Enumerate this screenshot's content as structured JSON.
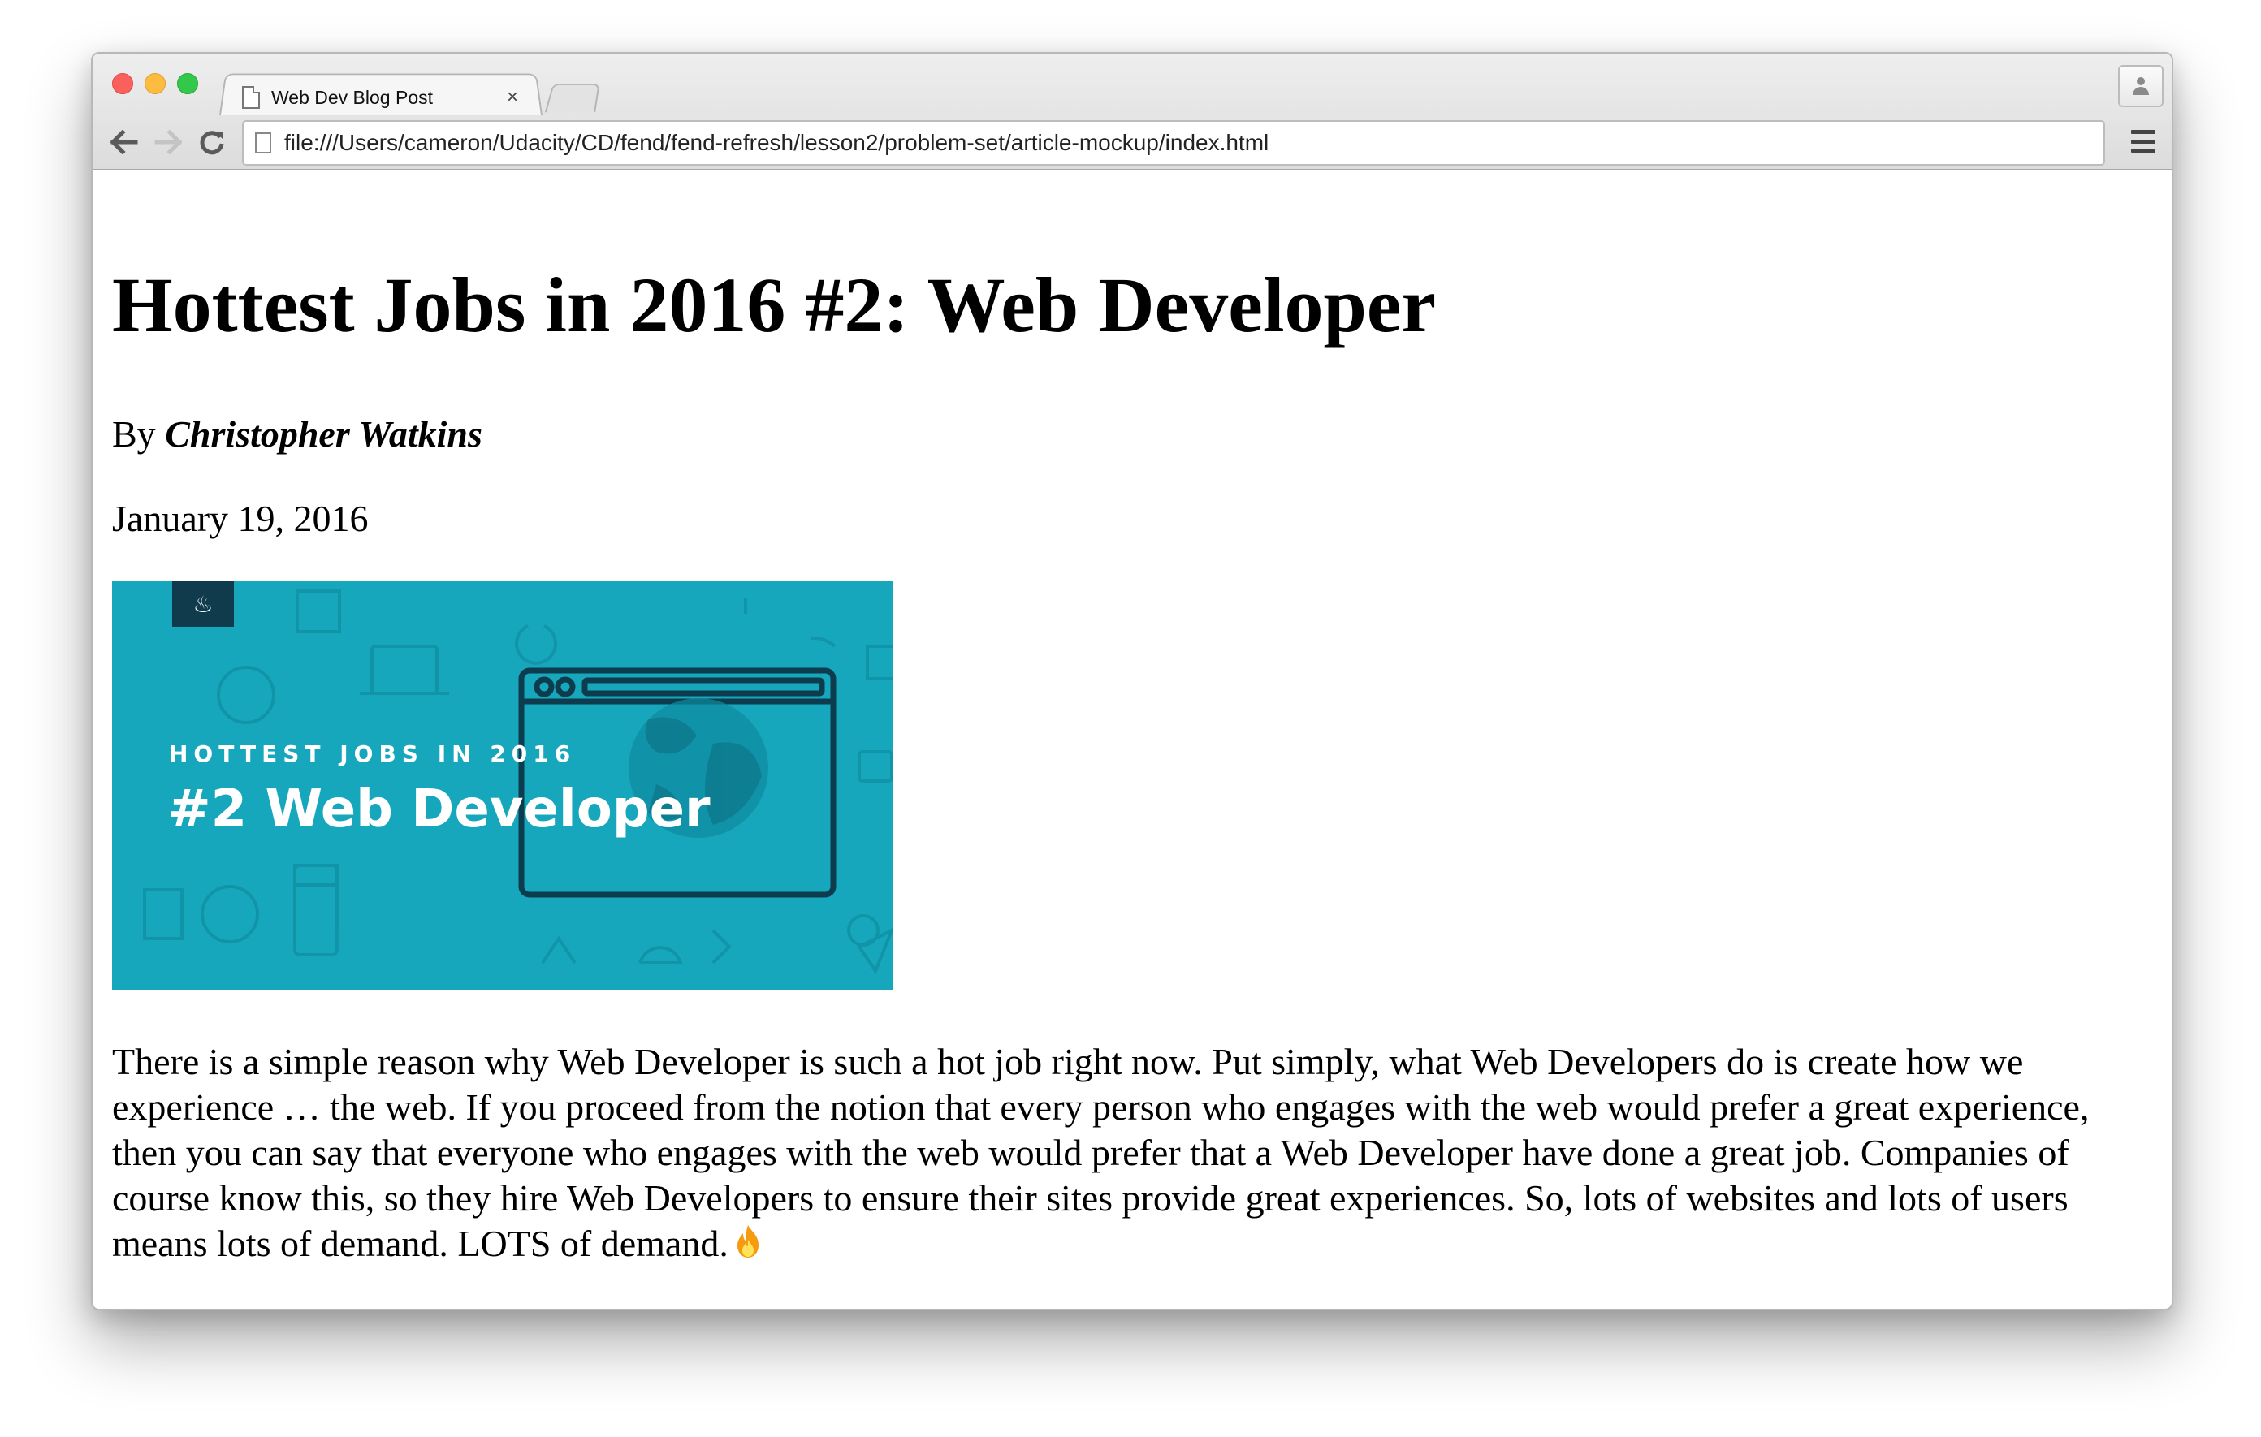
{
  "browser": {
    "tab_title": "Web Dev Blog Post",
    "tab_close_glyph": "×",
    "url": "file:///Users/cameron/Udacity/CD/fend/fend-refresh/lesson2/problem-set/article-mockup/index.html",
    "icons": {
      "back": "back-arrow-icon",
      "forward": "forward-arrow-icon",
      "reload": "reload-icon",
      "menu": "hamburger-menu-icon",
      "profile": "profile-icon",
      "page": "page-icon"
    }
  },
  "article": {
    "title": "Hottest Jobs in 2016 #2: Web Developer",
    "byline_prefix": "By ",
    "author": "Christopher Watkins",
    "date": "January 19, 2016",
    "hero_image": {
      "kicker": "HOTTEST JOBS IN 2016",
      "headline": "#2 Web Developer",
      "background_color": "#17a7bc",
      "badge_color": "#0f3b4c"
    },
    "body": "There is a simple reason why Web Developer is such a hot job right now. Put simply, what Web Developers do is create how we experience … the web. If you proceed from the notion that every person who engages with the web would prefer a great experience, then you can say that everyone who engages with the web would prefer that a Web Developer have done a great job. Companies of course know this, so they hire Web Developers to ensure their sites provide great experiences. So, lots of websites and lots of users means lots of demand. LOTS of demand.",
    "body_emoji": "fire-emoji"
  }
}
